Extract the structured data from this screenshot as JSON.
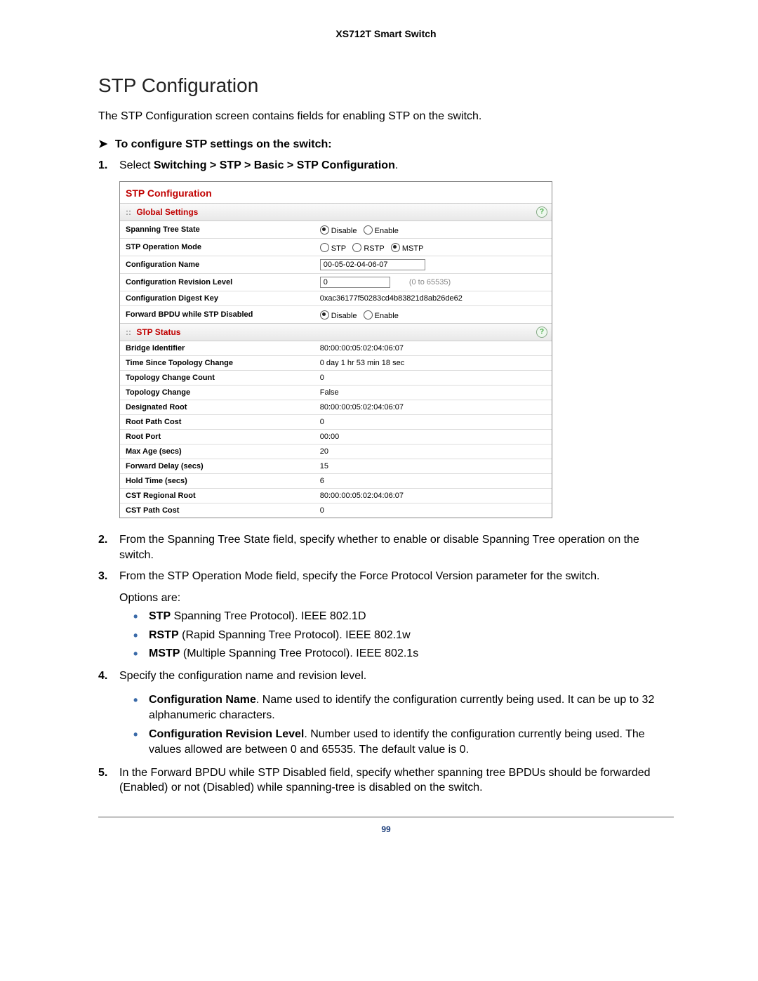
{
  "header": {
    "product": "XS712T Smart Switch"
  },
  "section": {
    "title": "STP Configuration",
    "intro": "The STP Configuration screen contains fields for enabling STP on the switch.",
    "subhead": "To configure STP settings on the switch:"
  },
  "steps": {
    "s1_prefix": "Select ",
    "s1_bold": "Switching > STP > Basic > STP Configuration",
    "s1_suffix": ".",
    "s2": "From the Spanning Tree State field, specify whether to enable or disable Spanning Tree operation on the switch.",
    "s3": "From the STP Operation Mode field, specify the Force Protocol Version parameter for the switch.",
    "s4": "Specify the configuration name and revision level.",
    "s5": "In the Forward BPDU while STP Disabled field, specify whether spanning tree BPDUs should be forwarded (Enabled) or not (Disabled) while spanning-tree is disabled on the switch."
  },
  "options_label": "Options are:",
  "options": {
    "stp_b": "STP",
    "stp_t": " Spanning Tree Protocol). IEEE 802.1D",
    "rstp_b": "RSTP",
    "rstp_t": " (Rapid Spanning Tree Protocol). IEEE 802.1w",
    "mstp_b": "MSTP",
    "mstp_t": " (Multiple Spanning Tree Protocol). IEEE 802.1s"
  },
  "config_desc": {
    "name_b": "Configuration Name",
    "name_t": ". Name used to identify the configuration currently being used. It can be up to 32 alphanumeric characters.",
    "rev_b": "Configuration Revision Level",
    "rev_t": ". Number used to identify the configuration currently being used. The values allowed are between 0 and 65535. The default value is 0."
  },
  "panel": {
    "title": "STP Configuration",
    "global_header": "Global Settings",
    "status_header": "STP Status",
    "help": "?",
    "global": {
      "spanning_state_label": "Spanning Tree State",
      "disable": "Disable",
      "enable": "Enable",
      "op_mode_label": "STP Operation Mode",
      "stp": "STP",
      "rstp": "RSTP",
      "mstp": "MSTP",
      "conf_name_label": "Configuration Name",
      "conf_name_value": "00-05-02-04-06-07",
      "rev_level_label": "Configuration Revision Level",
      "rev_level_value": "0",
      "rev_hint": "(0 to 65535)",
      "digest_label": "Configuration Digest Key",
      "digest_value": "0xac36177f50283cd4b83821d8ab26de62",
      "fwd_bpdu_label": "Forward BPDU while STP Disabled"
    },
    "status": {
      "bridge_id_l": "Bridge Identifier",
      "bridge_id_v": "80:00:00:05:02:04:06:07",
      "time_l": "Time Since Topology Change",
      "time_v": "0 day 1 hr 53 min 18 sec",
      "count_l": "Topology Change Count",
      "count_v": "0",
      "change_l": "Topology Change",
      "change_v": "False",
      "desroot_l": "Designated Root",
      "desroot_v": "80:00:00:05:02:04:06:07",
      "rootcost_l": "Root Path Cost",
      "rootcost_v": "0",
      "rootport_l": "Root Port",
      "rootport_v": "00:00",
      "maxage_l": "Max Age (secs)",
      "maxage_v": "20",
      "fwddelay_l": "Forward Delay (secs)",
      "fwddelay_v": "15",
      "hold_l": "Hold Time (secs)",
      "hold_v": "6",
      "cstroot_l": "CST Regional Root",
      "cstroot_v": "80:00:00:05:02:04:06:07",
      "cstcost_l": "CST Path Cost",
      "cstcost_v": "0"
    }
  },
  "footer": {
    "page": "99"
  }
}
